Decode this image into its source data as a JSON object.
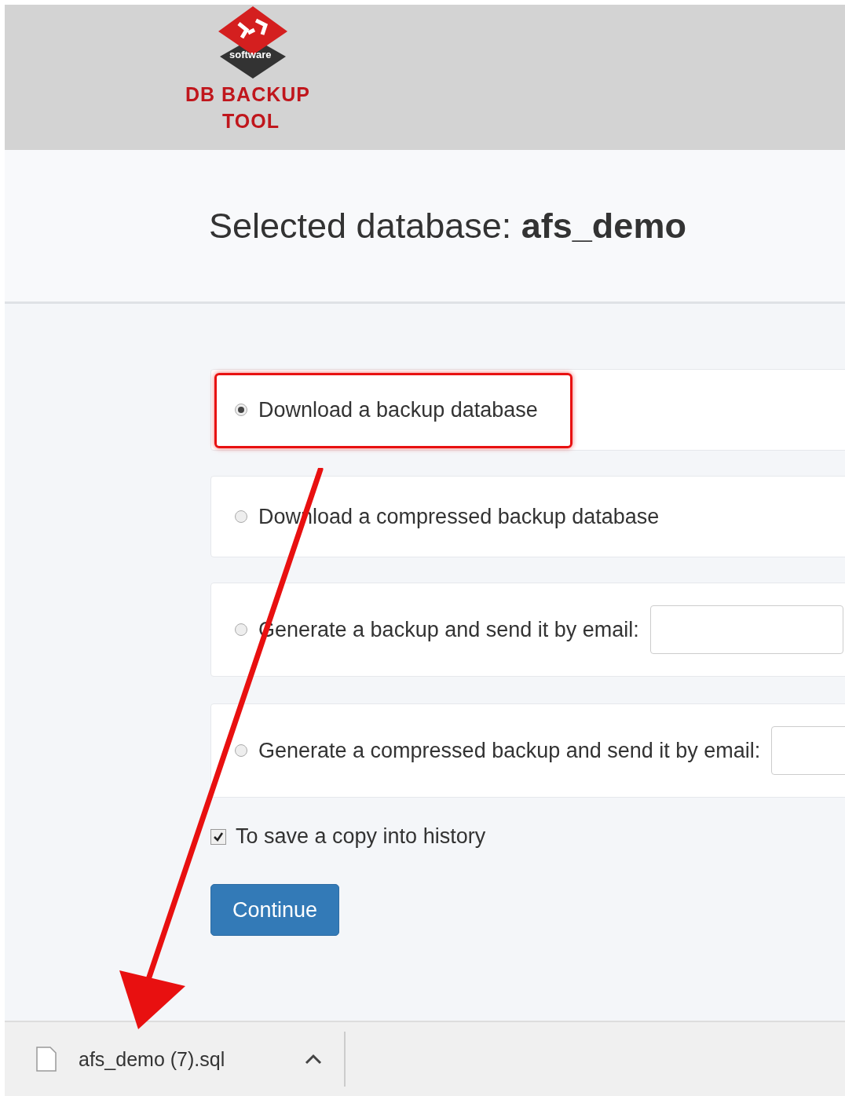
{
  "header": {
    "logo_text": "software",
    "title_line_1": "DB BACKUP",
    "title_line_2": "TOOL"
  },
  "heading": "Selected database: **afs_demo**",
  "options": [
    {
      "kind": "radio",
      "label": "Download a backup database",
      "selected": true,
      "highlighted": true
    },
    {
      "kind": "radio",
      "label": "Download a compressed backup database",
      "selected": false,
      "highlighted": false
    },
    {
      "kind": "email",
      "label": "Generate a backup and send it by email:",
      "selected": false,
      "highlighted": false
    },
    {
      "kind": "email",
      "label": "Generate a compressed backup and send it by email:",
      "selected": false,
      "highlighted": false
    }
  ],
  "history": {
    "label": "To save a copy into history",
    "checked": true
  },
  "continue_button": "Continue",
  "download_bar": {
    "file_name": "afs_demo (7).sql"
  }
}
